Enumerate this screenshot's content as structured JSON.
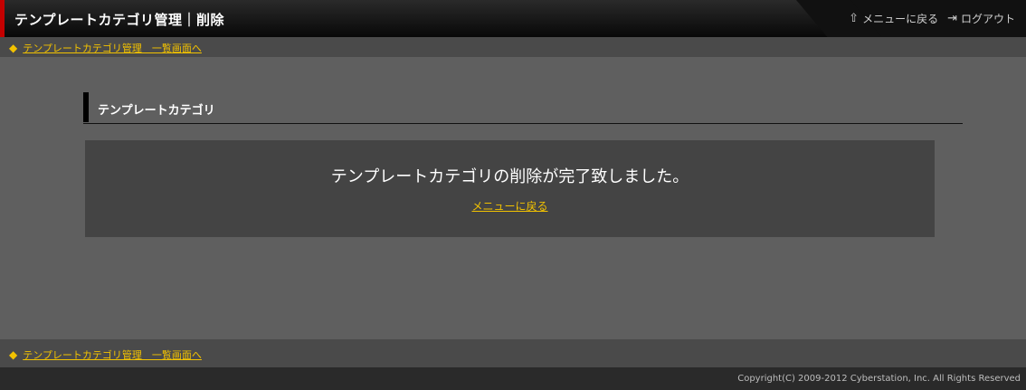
{
  "header": {
    "title": "テンプレートカテゴリ管理｜削除",
    "nav": {
      "menu_label": "メニューに戻る",
      "logout_label": "ログアウト"
    }
  },
  "breadcrumb": {
    "top_label": "テンプレートカテゴリ管理　一覧画面へ",
    "bottom_label": "テンプレートカテゴリ管理　一覧画面へ"
  },
  "section": {
    "heading": "テンプレートカテゴリ"
  },
  "message": {
    "text": "テンプレートカテゴリの削除が完了致しました。",
    "back_link": "メニューに戻る"
  },
  "footer": {
    "copyright": "Copyright(C) 2009-2012 Cyberstation, Inc. All Rights Reserved"
  },
  "colors": {
    "accent": "#c40000",
    "link": "#f2c200",
    "background": "#5f5f5f"
  }
}
